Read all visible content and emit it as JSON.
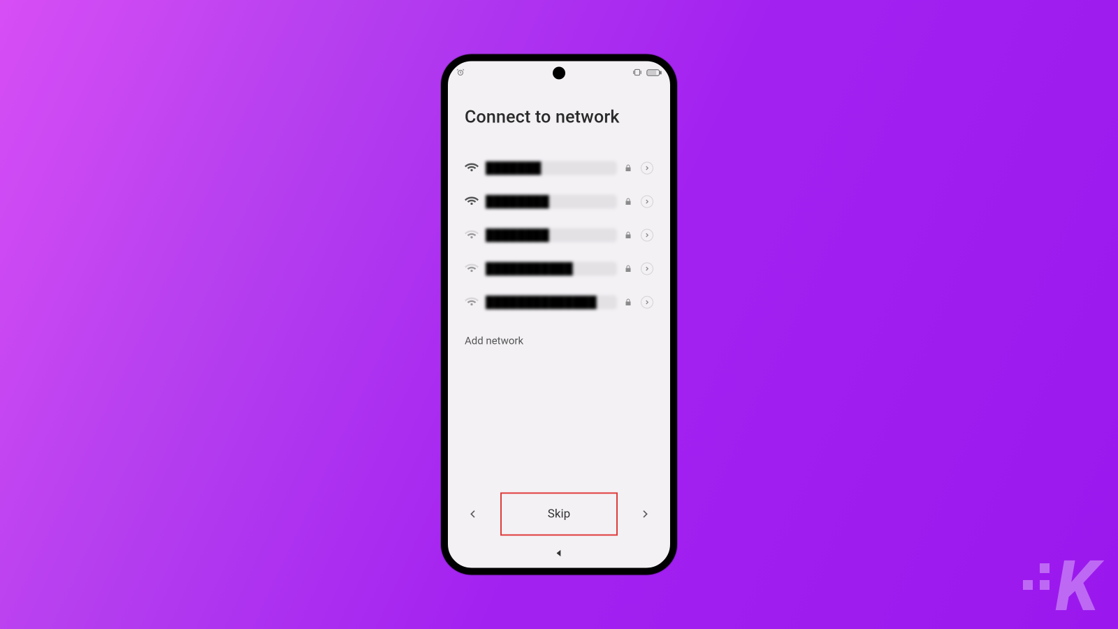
{
  "page": {
    "title": "Connect to network"
  },
  "networks": [
    {
      "name_hidden": "███████",
      "secured": true,
      "signal": "strong"
    },
    {
      "name_hidden": "████████",
      "secured": true,
      "signal": "strong"
    },
    {
      "name_hidden": "████████",
      "secured": true,
      "signal": "weak"
    },
    {
      "name_hidden": "███████████",
      "secured": true,
      "signal": "weak"
    },
    {
      "name_hidden": "██████████████",
      "secured": true,
      "signal": "weak"
    }
  ],
  "actions": {
    "add_network": "Add network",
    "skip": "Skip"
  },
  "watermark": {
    "letter": "K"
  }
}
